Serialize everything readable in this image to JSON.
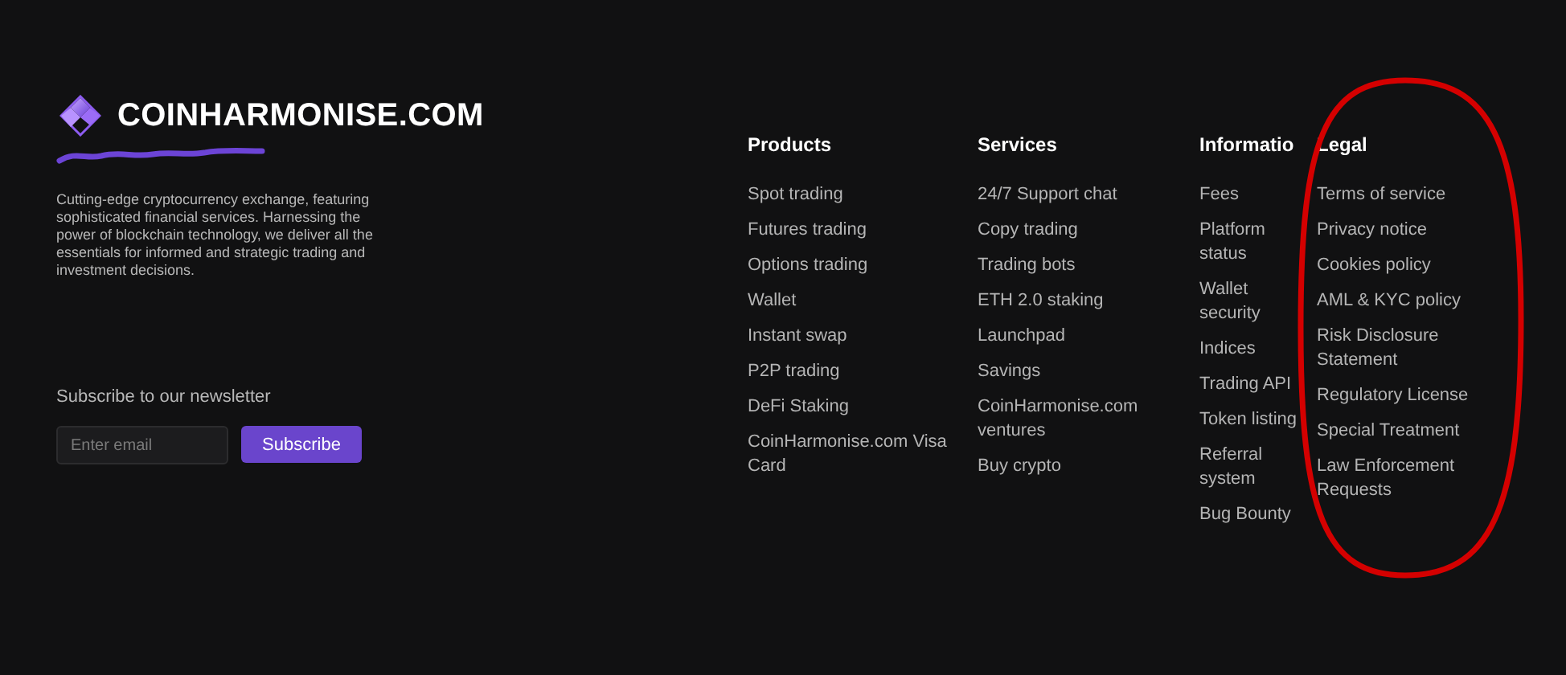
{
  "brand": {
    "name": "COINHARMONISE.COM",
    "description": "Cutting-edge cryptocurrency exchange, featuring sophisticated financial services. Harnessing the power of blockchain technology, we deliver all the essentials for informed and strategic trading and investment decisions."
  },
  "newsletter": {
    "label": "Subscribe to our newsletter",
    "placeholder": "Enter email",
    "button": "Subscribe"
  },
  "columns": [
    {
      "heading": "Products",
      "items": [
        "Spot trading",
        "Futures trading",
        "Options trading",
        "Wallet",
        "Instant swap",
        "P2P trading",
        "DeFi Staking",
        "CoinHarmonise.com Visa Card"
      ]
    },
    {
      "heading": "Services",
      "items": [
        "24/7 Support chat",
        "Copy trading",
        "Trading bots",
        "ETH 2.0 staking",
        "Launchpad",
        "Savings",
        "CoinHarmonise.com ventures",
        "Buy crypto"
      ]
    },
    {
      "heading": "Informatio",
      "items": [
        "Fees",
        "Platform status",
        "Wallet security",
        "Indices",
        "Trading API",
        "Token listing",
        "Referral system",
        "Bug Bounty"
      ]
    },
    {
      "heading": "Legal",
      "items": [
        "Terms of service",
        "Privacy notice",
        "Cookies policy",
        "AML & KYC policy",
        "Risk Disclosure Statement",
        "Regulatory License",
        "Special Treatment",
        "Law Enforcement Requests"
      ]
    }
  ]
}
